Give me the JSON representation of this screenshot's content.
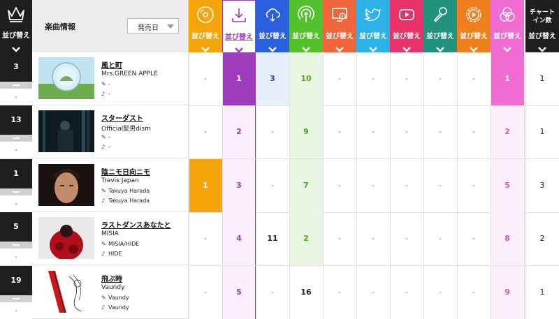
{
  "header": {
    "sort_label": "並び替え",
    "song_info_label": "楽曲情報",
    "sort_select_value": "発売日",
    "chart_in_label_1": "チャート",
    "chart_in_label_2": "イン数",
    "chart_in_sort": "並び替え"
  },
  "columns": [
    {
      "name": "cd-sales",
      "icon": "cd-icon",
      "color": "#f5a50a",
      "label": "並び替え"
    },
    {
      "name": "download",
      "icon": "download-icon",
      "color": "#ffffff",
      "label": "並び替え"
    },
    {
      "name": "streaming",
      "icon": "cloud-streaming-icon",
      "color": "#2a5fe0",
      "label": "並び替え"
    },
    {
      "name": "radio",
      "icon": "radio-broadcast-icon",
      "color": "#53c12c",
      "label": "並び替え"
    },
    {
      "name": "lookup",
      "icon": "pc-lookup-icon",
      "color": "#f0663a",
      "label": "並び替え"
    },
    {
      "name": "twitter",
      "icon": "twitter-icon",
      "color": "#2bb2e8",
      "label": "並び替え"
    },
    {
      "name": "youtube",
      "icon": "youtube-icon",
      "color": "#e8336a",
      "label": "並び替え"
    },
    {
      "name": "karaoke",
      "icon": "microphone-icon",
      "color": "#21927e",
      "label": "並び替え"
    },
    {
      "name": "gyao",
      "icon": "video-gyao-icon",
      "color": "#f07f1e",
      "label": "並び替え"
    },
    {
      "name": "hot100",
      "icon": "overlap-circles-icon",
      "color": "#f16cd1",
      "label": "並び替え"
    }
  ],
  "rows": [
    {
      "prev_rank": "3",
      "low": "-",
      "title": "風と町",
      "artist": "Mrs.GREEN APPLE",
      "lyricist": "-",
      "composer": "-",
      "thumb": "art-1",
      "values": [
        "-",
        "1",
        "3",
        "10",
        "-",
        "-",
        "-",
        "-",
        "-",
        "1"
      ],
      "chart_in": "1"
    },
    {
      "prev_rank": "13",
      "low": "-",
      "title": "スターダスト",
      "artist": "Official髭男dism",
      "lyricist": "-",
      "composer": "-",
      "thumb": "art-2",
      "values": [
        "-",
        "2",
        "-",
        "9",
        "-",
        "-",
        "-",
        "-",
        "-",
        "2"
      ],
      "chart_in": "1"
    },
    {
      "prev_rank": "1",
      "low": "-",
      "title": "陰ニモ日向ニモ",
      "artist": "Travis Japan",
      "lyricist": "Takuya Harada",
      "composer": "Takuya Harada",
      "thumb": "art-3",
      "values": [
        "1",
        "3",
        "-",
        "7",
        "-",
        "-",
        "-",
        "-",
        "-",
        "5"
      ],
      "chart_in": "3"
    },
    {
      "prev_rank": "5",
      "low": "-",
      "title": "ラストダンスあなたと",
      "artist": "MISIA",
      "lyricist": "MISIA/HIDE",
      "composer": "HIDE",
      "thumb": "art-4",
      "values": [
        "-",
        "4",
        "11",
        "2",
        "-",
        "-",
        "-",
        "-",
        "-",
        "8"
      ],
      "chart_in": "2"
    },
    {
      "prev_rank": "19",
      "low": "-",
      "title": "飛ぶ時",
      "artist": "Vaundy",
      "lyricist": "Vaundy",
      "composer": "Vaundy",
      "thumb": "art-5",
      "values": [
        "-",
        "5",
        "-",
        "16",
        "-",
        "-",
        "-",
        "-",
        "-",
        "9"
      ],
      "chart_in": "1"
    }
  ]
}
